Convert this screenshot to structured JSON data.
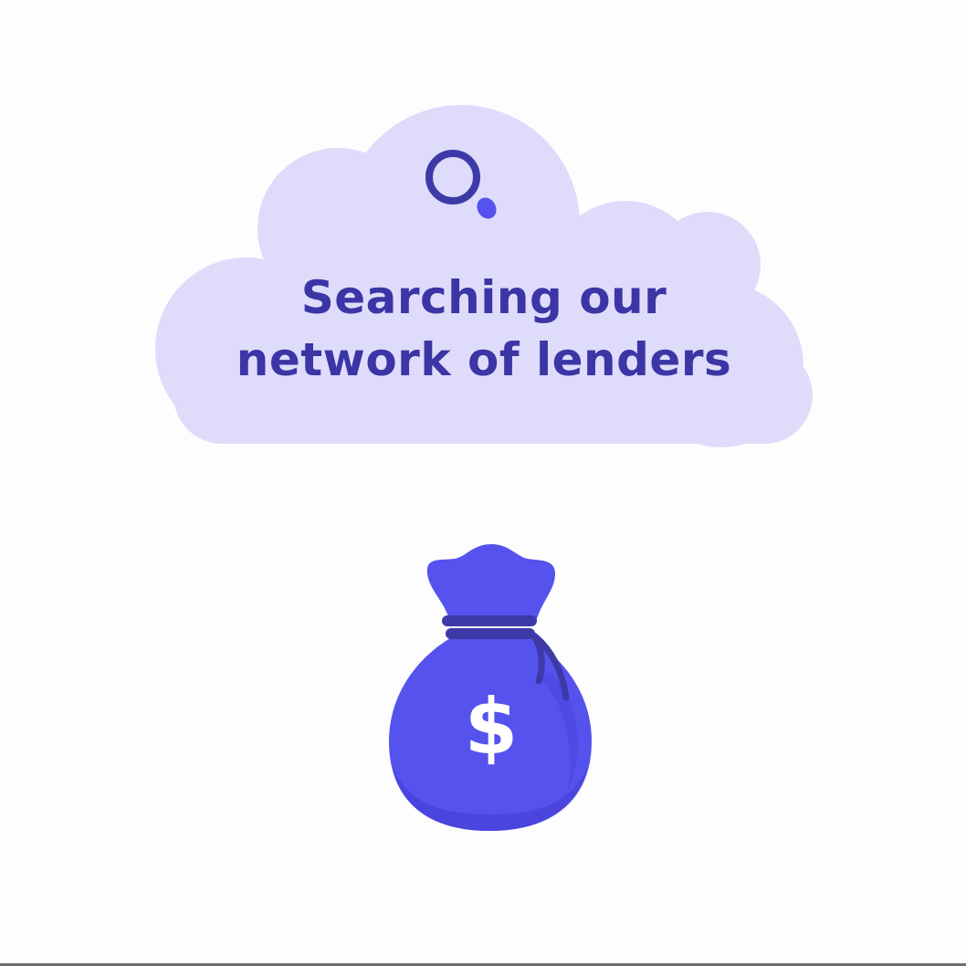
{
  "message": {
    "line1": "Searching our",
    "line2": "network of lenders"
  },
  "bag": {
    "currency_symbol": "$"
  },
  "icons": {
    "cloud": "cloud-shape",
    "search": "search-icon",
    "bag": "money-bag-icon"
  },
  "colors": {
    "background": "#fdfdfe",
    "cloud": "#dedcfa",
    "text": "#3b35a5",
    "accent": "#5652ee",
    "accent_dark": "#3d3aa8"
  }
}
